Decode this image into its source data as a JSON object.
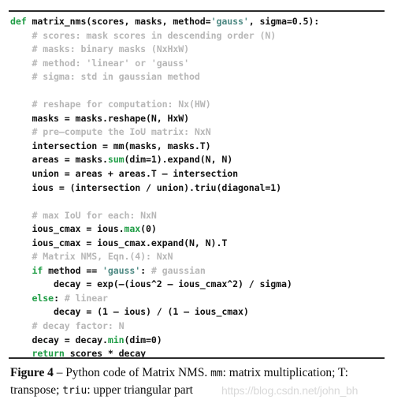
{
  "figure": {
    "rule_color": "#2b2b2b",
    "caption": {
      "label": "Figure 4",
      "dash": " – ",
      "text_1": "Python code of Matrix NMS. ",
      "mono_1": "mm",
      "text_2": ": matrix multiplication; T: transpose; ",
      "mono_2": "triu",
      "text_3": ": upper triangular part"
    },
    "watermark": "https://blog.csdn.net/john_bh"
  },
  "colors": {
    "keyword": "#1f9d45",
    "builtin": "#1f9d45",
    "string": "#4f8a84",
    "comment": "#b7b7b7",
    "code_text": "#111111"
  },
  "code": {
    "language": "python",
    "lines": [
      {
        "n": 1,
        "text": "def matrix_nms(scores, masks, method='gauss', sigma=0.5):",
        "segments": [
          {
            "t": "def",
            "k": "kw"
          },
          {
            "t": " matrix_nms(scores, masks, method=",
            "k": "plain"
          },
          {
            "t": "'gauss'",
            "k": "str"
          },
          {
            "t": ", sigma=0.5):",
            "k": "plain"
          }
        ]
      },
      {
        "n": 2,
        "text": "    # scores: mask scores in descending order (N)",
        "segments": [
          {
            "t": "    ",
            "k": "plain"
          },
          {
            "t": "# scores: mask scores in descending order (N)",
            "k": "cmt"
          }
        ]
      },
      {
        "n": 3,
        "text": "    # masks: binary masks (NxHxW)",
        "segments": [
          {
            "t": "    ",
            "k": "plain"
          },
          {
            "t": "# masks: binary masks (NxHxW)",
            "k": "cmt"
          }
        ]
      },
      {
        "n": 4,
        "text": "    # method: 'linear' or 'gauss'",
        "segments": [
          {
            "t": "    ",
            "k": "plain"
          },
          {
            "t": "# method: 'linear' or 'gauss'",
            "k": "cmt"
          }
        ]
      },
      {
        "n": 5,
        "text": "    # sigma: std in gaussian method",
        "segments": [
          {
            "t": "    ",
            "k": "plain"
          },
          {
            "t": "# sigma: std in gaussian method",
            "k": "cmt"
          }
        ]
      },
      {
        "n": 6,
        "text": "",
        "segments": []
      },
      {
        "n": 7,
        "text": "    # reshape for computation: Nx(HW)",
        "segments": [
          {
            "t": "    ",
            "k": "plain"
          },
          {
            "t": "# reshape for computation: Nx(HW)",
            "k": "cmt"
          }
        ]
      },
      {
        "n": 8,
        "text": "    masks = masks.reshape(N, HxW)",
        "segments": [
          {
            "t": "    masks = masks.reshape(N, HxW)",
            "k": "plain"
          }
        ]
      },
      {
        "n": 9,
        "text": "    # pre—compute the IoU matrix: NxN",
        "segments": [
          {
            "t": "    ",
            "k": "plain"
          },
          {
            "t": "# pre—compute the IoU matrix: NxN",
            "k": "cmt"
          }
        ]
      },
      {
        "n": 10,
        "text": "    intersection = mm(masks, masks.T)",
        "segments": [
          {
            "t": "    intersection = mm(masks, masks.T)",
            "k": "plain"
          }
        ]
      },
      {
        "n": 11,
        "text": "    areas = masks.sum(dim=1).expand(N, N)",
        "segments": [
          {
            "t": "    areas = masks.",
            "k": "plain"
          },
          {
            "t": "sum",
            "k": "builtin"
          },
          {
            "t": "(dim=1).expand(N, N)",
            "k": "plain"
          }
        ]
      },
      {
        "n": 12,
        "text": "    union = areas + areas.T — intersection",
        "segments": [
          {
            "t": "    union = areas + areas.T — intersection",
            "k": "plain"
          }
        ]
      },
      {
        "n": 13,
        "text": "    ious = (intersection / union).triu(diagonal=1)",
        "segments": [
          {
            "t": "    ious = (intersection / union).triu(diagonal=1)",
            "k": "plain"
          }
        ]
      },
      {
        "n": 14,
        "text": "",
        "segments": []
      },
      {
        "n": 15,
        "text": "    # max IoU for each: NxN",
        "segments": [
          {
            "t": "    ",
            "k": "plain"
          },
          {
            "t": "# max IoU for each: NxN",
            "k": "cmt"
          }
        ]
      },
      {
        "n": 16,
        "text": "    ious_cmax = ious.max(0)",
        "segments": [
          {
            "t": "    ious_cmax = ious.",
            "k": "plain"
          },
          {
            "t": "max",
            "k": "builtin"
          },
          {
            "t": "(0)",
            "k": "plain"
          }
        ]
      },
      {
        "n": 17,
        "text": "    ious_cmax = ious_cmax.expand(N, N).T",
        "segments": [
          {
            "t": "    ious_cmax = ious_cmax.expand(N, N).T",
            "k": "plain"
          }
        ]
      },
      {
        "n": 18,
        "text": "    # Matrix NMS, Eqn.(4): NxN",
        "segments": [
          {
            "t": "    ",
            "k": "plain"
          },
          {
            "t": "# Matrix NMS, Eqn.(4): NxN",
            "k": "cmt"
          }
        ]
      },
      {
        "n": 19,
        "text": "    if method == 'gauss': # gaussian",
        "segments": [
          {
            "t": "    ",
            "k": "plain"
          },
          {
            "t": "if",
            "k": "kw"
          },
          {
            "t": " method == ",
            "k": "plain"
          },
          {
            "t": "'gauss'",
            "k": "str"
          },
          {
            "t": ": ",
            "k": "plain"
          },
          {
            "t": "# gaussian",
            "k": "cmt"
          }
        ]
      },
      {
        "n": 20,
        "text": "        decay = exp(—(ious^2 — ious_cmax^2) / sigma)",
        "segments": [
          {
            "t": "        decay = exp(—(ious^2 — ious_cmax^2) / sigma)",
            "k": "plain"
          }
        ]
      },
      {
        "n": 21,
        "text": "    else: # linear",
        "segments": [
          {
            "t": "    ",
            "k": "plain"
          },
          {
            "t": "else",
            "k": "kw"
          },
          {
            "t": ": ",
            "k": "plain"
          },
          {
            "t": "# linear",
            "k": "cmt"
          }
        ]
      },
      {
        "n": 22,
        "text": "        decay = (1 — ious) / (1 — ious_cmax)",
        "segments": [
          {
            "t": "        decay = (1 — ious) / (1 — ious_cmax)",
            "k": "plain"
          }
        ]
      },
      {
        "n": 23,
        "text": "    # decay factor: N",
        "segments": [
          {
            "t": "    ",
            "k": "plain"
          },
          {
            "t": "# decay factor: N",
            "k": "cmt"
          }
        ]
      },
      {
        "n": 24,
        "text": "    decay = decay.min(dim=0)",
        "segments": [
          {
            "t": "    decay = decay.",
            "k": "plain"
          },
          {
            "t": "min",
            "k": "builtin"
          },
          {
            "t": "(dim=0)",
            "k": "plain"
          }
        ]
      },
      {
        "n": 25,
        "text": "    return scores * decay",
        "segments": [
          {
            "t": "    ",
            "k": "plain"
          },
          {
            "t": "return",
            "k": "kw"
          },
          {
            "t": " scores * decay",
            "k": "plain"
          }
        ]
      }
    ]
  }
}
